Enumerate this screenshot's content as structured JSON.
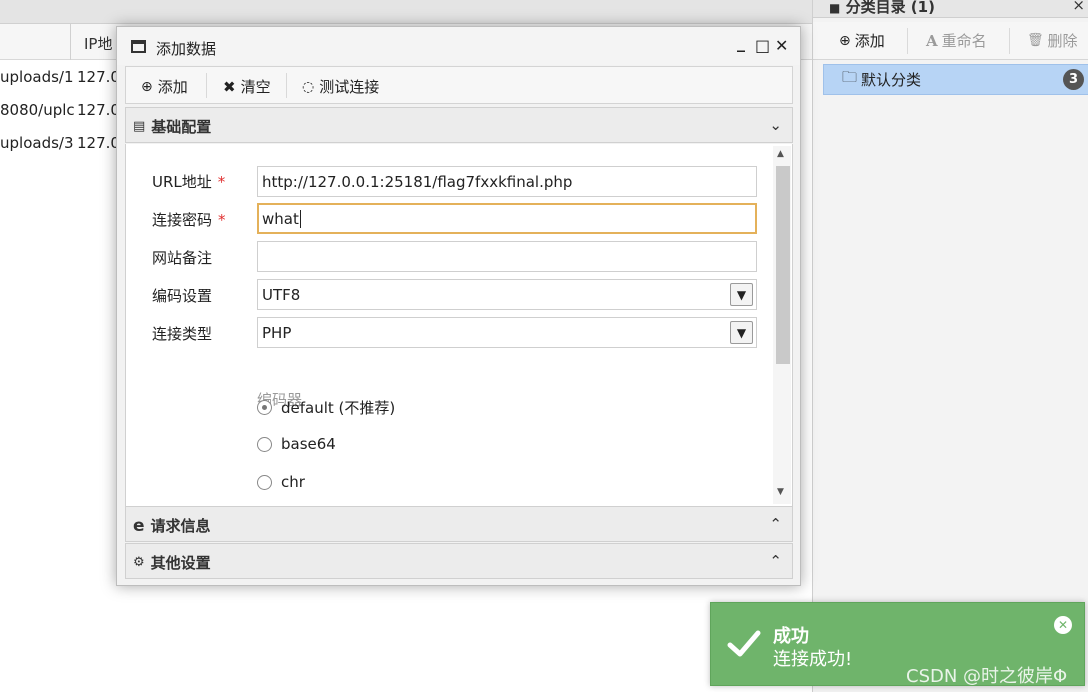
{
  "background_table": {
    "column_header": "IP地",
    "rows": [
      {
        "url": "uploads/1.",
        "ip": "127.0"
      },
      {
        "url": "8080/uplc",
        "ip": "127.0"
      },
      {
        "url": "uploads/3.",
        "ip": "127.0"
      }
    ]
  },
  "sidebar": {
    "title": "分类目录 (1)",
    "close": "×",
    "toolbar": {
      "add": "添加",
      "rename": "重命名",
      "delete": "删除"
    },
    "categories": [
      {
        "label": "默认分类",
        "count": "3"
      }
    ]
  },
  "dialog": {
    "title": "添加数据",
    "controls": {
      "minimize": "_",
      "maximize": "□",
      "close": "✕"
    },
    "toolbar": {
      "add": "添加",
      "clear": "清空",
      "test": "测试连接"
    },
    "panels": {
      "basic": "基础配置",
      "request": "请求信息",
      "other": "其他设置"
    },
    "form": {
      "url_label": "URL地址",
      "url_value": "http://127.0.0.1:25181/flag7fxxkfinal.php",
      "password_label": "连接密码",
      "password_value": "what",
      "note_label": "网站备注",
      "note_value": "",
      "encoding_label": "编码设置",
      "encoding_value": "UTF8",
      "type_label": "连接类型",
      "type_value": "PHP",
      "required_mark": "*",
      "encoder_title": "编码器",
      "encoders": [
        {
          "label": "default (不推荐)",
          "selected": true
        },
        {
          "label": "base64",
          "selected": false
        },
        {
          "label": "chr",
          "selected": false
        }
      ]
    }
  },
  "toast": {
    "title": "成功",
    "message": "连接成功!",
    "color": "#6fb46b"
  },
  "watermark": "CSDN @时之彼岸Φ"
}
